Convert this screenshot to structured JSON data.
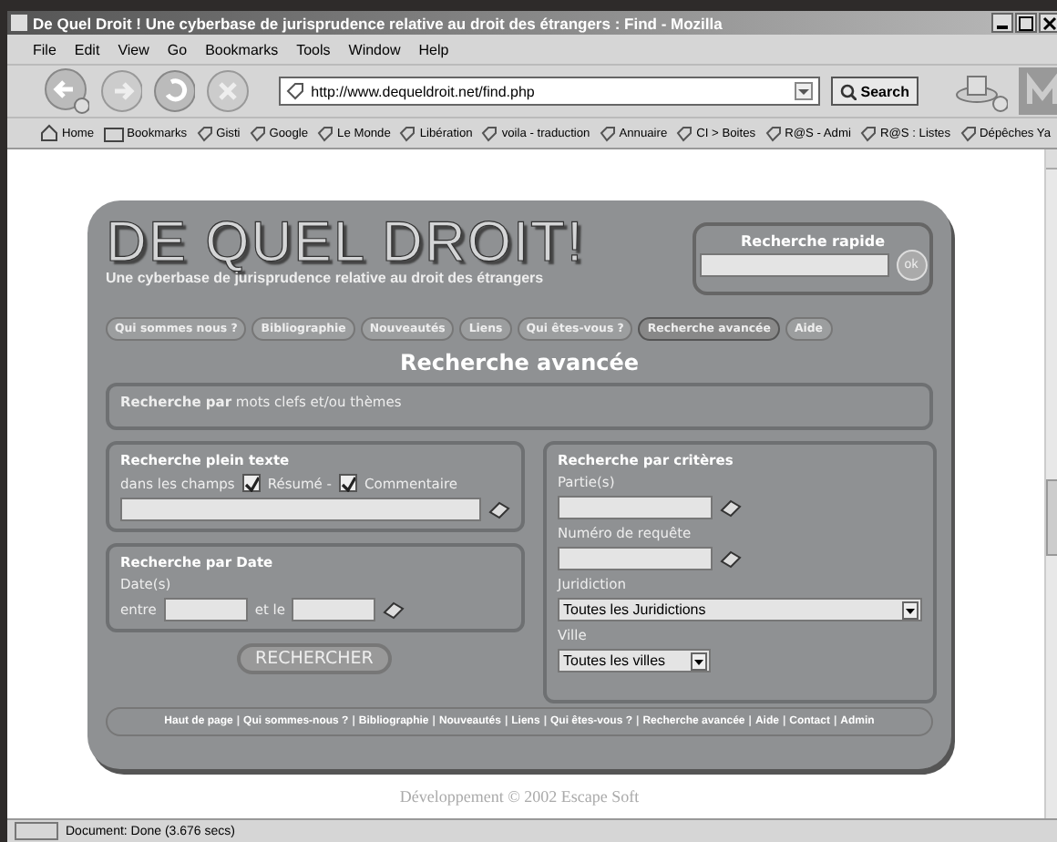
{
  "window": {
    "title": "De Quel Droit ! Une cyberbase de jurisprudence relative au droit des étrangers : Find - Mozilla"
  },
  "menu": [
    "File",
    "Edit",
    "View",
    "Go",
    "Bookmarks",
    "Tools",
    "Window",
    "Help"
  ],
  "address": {
    "value": "http://www.dequeldroit.net/find.php"
  },
  "search_button": "Search",
  "bookmarks": [
    {
      "label": "Home",
      "kind": "home"
    },
    {
      "label": "Bookmarks",
      "kind": "folder"
    },
    {
      "label": "Gisti",
      "kind": "link"
    },
    {
      "label": "Google",
      "kind": "link"
    },
    {
      "label": "Le Monde",
      "kind": "link"
    },
    {
      "label": "Libération",
      "kind": "link"
    },
    {
      "label": "voila - traduction",
      "kind": "link"
    },
    {
      "label": "Annuaire",
      "kind": "link"
    },
    {
      "label": "CI > Boites",
      "kind": "link"
    },
    {
      "label": "R@S - Admi",
      "kind": "link"
    },
    {
      "label": "R@S : Listes",
      "kind": "link"
    },
    {
      "label": "Dépêches Ya",
      "kind": "link"
    }
  ],
  "site": {
    "logo": "DE QUEL DROIT!",
    "tagline": "Une cyberbase de jurisprudence relative au droit des étrangers",
    "quick_search": {
      "title": "Recherche rapide",
      "button": "ok"
    },
    "nav": [
      {
        "label": "Qui sommes nous ?",
        "selected": false
      },
      {
        "label": "Bibliographie",
        "selected": false
      },
      {
        "label": "Nouveautés",
        "selected": false
      },
      {
        "label": "Liens",
        "selected": false
      },
      {
        "label": "Qui êtes-vous ?",
        "selected": false
      },
      {
        "label": "Recherche avancée",
        "selected": true
      },
      {
        "label": "Aide",
        "selected": false
      }
    ],
    "heading": "Recherche avancée",
    "keywords_box": "**Recherche par** mots clefs et/ou thèmes",
    "fulltext": {
      "title": "Recherche plein texte",
      "label": "dans les champs",
      "options": [
        {
          "label": "Résumé -",
          "checked": true
        },
        {
          "label": "Commentaire",
          "checked": true
        }
      ]
    },
    "date": {
      "title": "Recherche par Date",
      "label": "Date(s)",
      "from": "entre",
      "to": "et le"
    },
    "submit": "RECHERCHER",
    "criteria": {
      "title": "Recherche par critères",
      "parties": "Partie(s)",
      "request": "Numéro de requête",
      "jurisdiction_label": "Juridiction",
      "jurisdiction": "Toutes les Juridictions",
      "city_label": "Ville",
      "city": "Toutes les villes"
    },
    "footer_links": [
      "Haut de page",
      "Qui sommes-nous ?",
      "Bibliographie",
      "Nouveautés",
      "Liens",
      "Qui êtes-vous ?",
      "Recherche avancée",
      "Aide",
      "Contact",
      "Admin"
    ],
    "footer_separator": "|",
    "credit": "Développement © 2002 Escape Soft"
  },
  "status_bar": "Document: Done (3.676 secs)"
}
